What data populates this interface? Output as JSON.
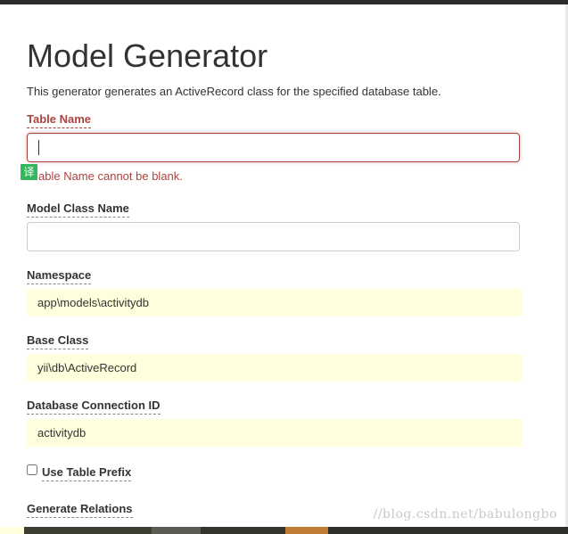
{
  "page": {
    "title": "Model Generator",
    "description": "This generator generates an ActiveRecord class for the specified database table."
  },
  "form": {
    "table_name": {
      "label": "Table Name",
      "value": "",
      "error": "able Name cannot be blank."
    },
    "model_class": {
      "label": "Model Class Name",
      "value": ""
    },
    "namespace": {
      "label": "Namespace",
      "value": "app\\models\\activitydb"
    },
    "base_class": {
      "label": "Base Class",
      "value": "yii\\db\\ActiveRecord"
    },
    "db_connection": {
      "label": "Database Connection ID",
      "value": "activitydb"
    },
    "use_table_prefix": {
      "label": "Use Table Prefix",
      "checked": false
    },
    "generate_relations": {
      "label": "Generate Relations"
    }
  },
  "overlay": {
    "translate_badge": "译",
    "watermark": "//blog.csdn.net/babulongbo"
  },
  "colors": {
    "error": "#a94442",
    "sticky_bg": "#ffffdd"
  }
}
